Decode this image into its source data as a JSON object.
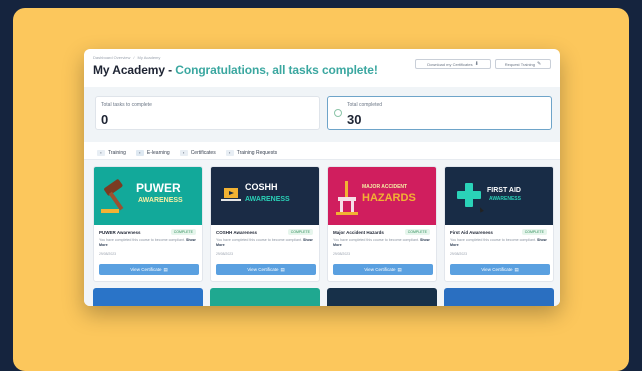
{
  "breadcrumb": [
    "Dashboard Overview",
    "/",
    "My Academy"
  ],
  "header": {
    "title_prefix": "My Academy - ",
    "title_highlight": "Congratulations, all tasks complete!",
    "download_label": "Download my Certificates",
    "request_label": "Request Training"
  },
  "stats": {
    "to_complete_label": "Total tasks to complete",
    "to_complete_value": "0",
    "completed_label": "Total completed",
    "completed_value": "30"
  },
  "tabs": [
    "Training",
    "E-learning",
    "Certificates",
    "Training Requests"
  ],
  "courses": [
    {
      "name": "PUWER Awareness",
      "status": "COMPLETE",
      "thumb_title": "PUWER",
      "thumb_sub": "AWARENESS",
      "desc": "You have completed this course to become compliant.",
      "more": "Show More",
      "date": "29/08/2023",
      "button": "View Certificate"
    },
    {
      "name": "COSHH Awareness",
      "status": "COMPLETE",
      "thumb_title": "COSHH",
      "thumb_sub": "AWARENESS",
      "desc": "You have completed this course to become compliant.",
      "more": "Show More",
      "date": "29/08/2023",
      "button": "View Certificate"
    },
    {
      "name": "Major Accident Hazards",
      "status": "COMPLETE",
      "thumb_title": "MAJOR ACCIDENT",
      "thumb_sub": "HAZARDS",
      "desc": "You have completed this course to become compliant.",
      "more": "Show More",
      "date": "29/08/2023",
      "button": "View Certificate"
    },
    {
      "name": "First Aid Awareness",
      "status": "COMPLETE",
      "thumb_title": "FIRST AID",
      "thumb_sub": "AWARENESS",
      "desc": "You have completed this course to become compliant.",
      "more": "Show More",
      "date": "29/08/2023",
      "button": "View Certificate"
    }
  ],
  "colors": {
    "frame": "#fcc75c",
    "background": "#15243e",
    "accent": "#3ba7a0",
    "button": "#5aa0e0"
  }
}
